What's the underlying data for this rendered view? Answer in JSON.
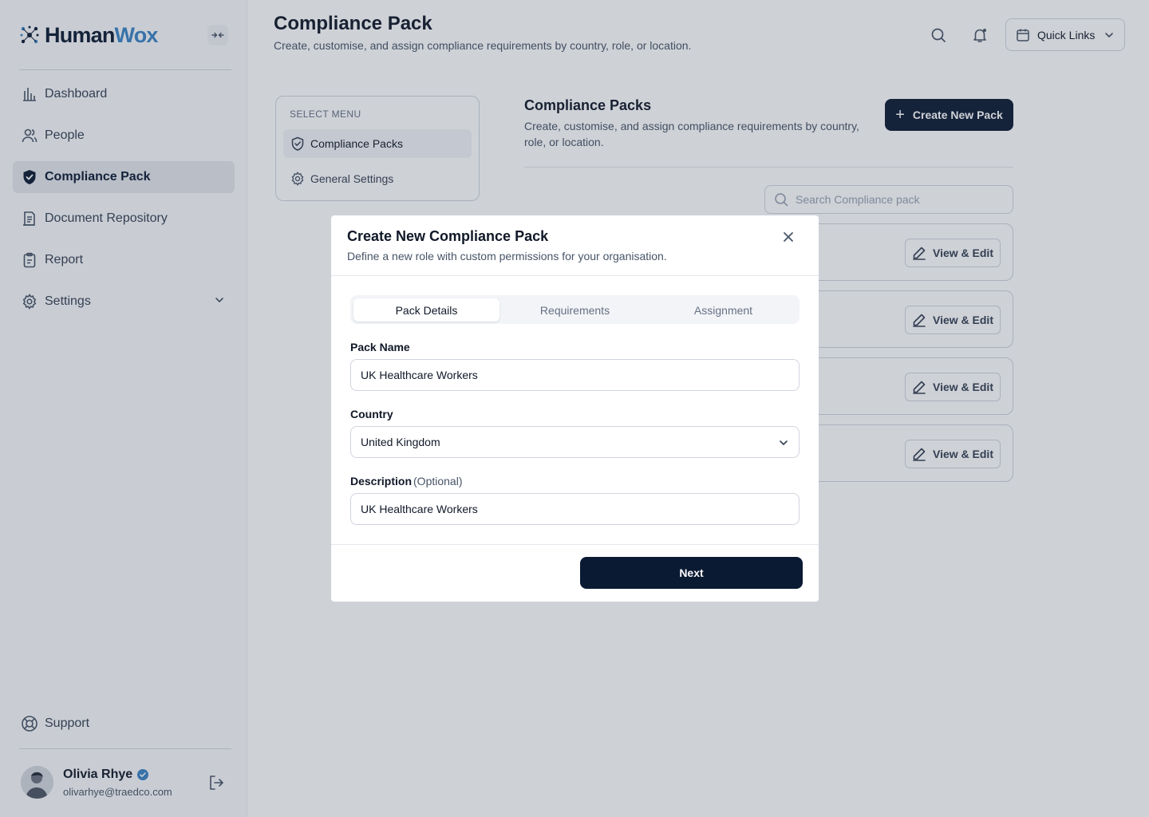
{
  "sidebar": {
    "logo": {
      "part1": "Human",
      "part2": "Wox"
    },
    "nav_items": [
      {
        "label": "Dashboard",
        "icon": "bar-chart-icon"
      },
      {
        "label": "People",
        "icon": "users-icon"
      },
      {
        "label": "Compliance Pack",
        "icon": "shield-check-icon",
        "active": true
      },
      {
        "label": "Document Repository",
        "icon": "document-icon"
      },
      {
        "label": "Report",
        "icon": "clipboard-icon"
      },
      {
        "label": "Settings",
        "icon": "gear-icon",
        "has_submenu": true
      }
    ],
    "support_label": "Support",
    "user": {
      "name": "Olivia Rhye",
      "email": "olivarhye@traedco.com"
    }
  },
  "header": {
    "title": "Compliance Pack",
    "subtitle": "Create, customise, and assign compliance requirements by country, role, or location.",
    "quick_links_label": "Quick Links"
  },
  "select_menu": {
    "label": "SELECT MENU",
    "items": [
      {
        "label": "Compliance Packs",
        "icon": "shield-check-icon",
        "active": true
      },
      {
        "label": "General Settings",
        "icon": "gear-icon"
      }
    ]
  },
  "content": {
    "title": "Compliance Packs",
    "description": "Create, customise, and assign compliance requirements by country, role, or location.",
    "create_button_label": "Create New Pack",
    "search_placeholder": "Search Compliance pack",
    "view_edit_label": "View & Edit"
  },
  "modal": {
    "title": "Create New Compliance Pack",
    "subtitle": "Define a new role with custom permissions for your organisation.",
    "tabs": [
      "Pack Details",
      "Requirements",
      "Assignment"
    ],
    "active_tab": "Pack Details",
    "pack_name_label": "Pack Name",
    "pack_name_value": "UK Healthcare Workers",
    "country_label": "Country",
    "country_value": "United Kingdom",
    "description_label": "Description",
    "description_optional": "(Optional)",
    "description_value": "UK Healthcare Workers",
    "next_label": "Next"
  },
  "colors": {
    "primary": "#0b1a33",
    "brand_accent": "#3b82c4",
    "overlay": "#344054"
  }
}
